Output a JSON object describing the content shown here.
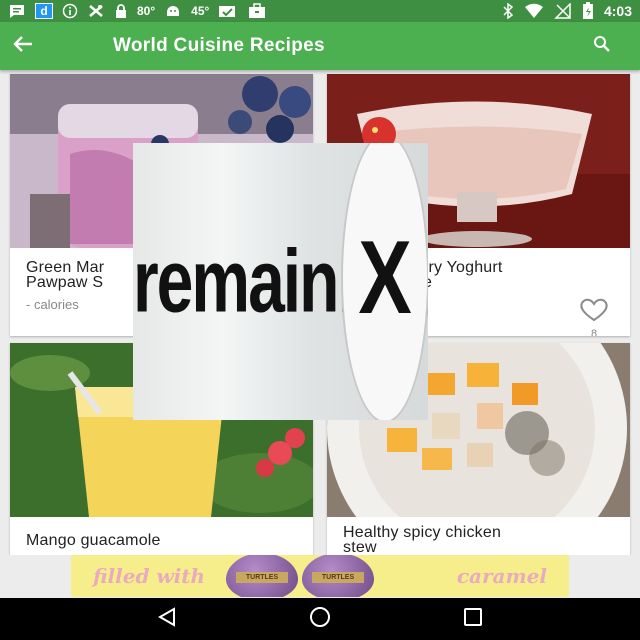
{
  "status_bar": {
    "left_icons": [
      "message-icon",
      "d-app-icon",
      "info-icon",
      "cross-fit-icon",
      "lock-icon"
    ],
    "d_badge": "d",
    "temp1": "80°",
    "temp2": "45°",
    "time": "4:03",
    "right_icons": [
      "bluetooth-icon",
      "wifi-icon",
      "no-signal-icon",
      "battery-charging-icon"
    ]
  },
  "app_bar": {
    "title": "World Cuisine Recipes",
    "back_icon": "arrow-back-icon",
    "search_icon": "search-icon",
    "color": "#4caf50"
  },
  "recipes": [
    {
      "title_line1": "Green Mar",
      "title_line2": "Pawpaw S",
      "meta": "- calories"
    },
    {
      "title_line1": "rry Yoghurt",
      "title_line2": "e",
      "likes": "8"
    },
    {
      "title_line1": "Mango guacamole"
    },
    {
      "title_line1": "Healthy spicy chicken",
      "title_line2": "stew"
    }
  ],
  "popup": {
    "text": "remaining",
    "close": "X"
  },
  "ad": {
    "text_left": "filled with",
    "text_right": "caramel",
    "egg_label": "TURTLES"
  },
  "nav": {
    "back": "nav-back-icon",
    "home": "nav-home-icon",
    "recents": "nav-recents-icon"
  }
}
